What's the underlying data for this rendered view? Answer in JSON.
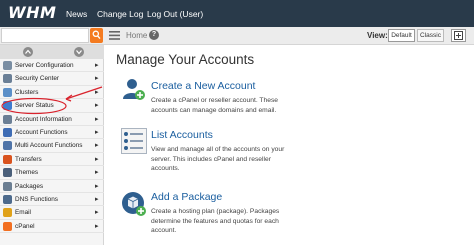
{
  "app": {
    "logo": "WHM"
  },
  "topnav": {
    "news": "News",
    "changelog": "Change Log",
    "logout": "Log Out (User)"
  },
  "breadcrumb": {
    "home": "Home",
    "help": "?"
  },
  "view": {
    "label": "View:",
    "default": "Default",
    "classic": "Classic"
  },
  "search": {
    "value": ""
  },
  "sidebar": {
    "items": [
      {
        "label": "Server Configuration",
        "icon": "server-config-icon",
        "color": "#7a8ea3"
      },
      {
        "label": "Security Center",
        "icon": "security-icon",
        "color": "#6a7f96"
      },
      {
        "label": "Clusters",
        "icon": "clusters-icon",
        "color": "#5b8fc8"
      },
      {
        "label": "Server Status",
        "icon": "server-status-icon",
        "color": "#3f7ccf"
      },
      {
        "label": "Account Information",
        "icon": "account-info-icon",
        "color": "#6b7f95"
      },
      {
        "label": "Account Functions",
        "icon": "account-functions-icon",
        "color": "#3f6db5"
      },
      {
        "label": "Multi Account Functions",
        "icon": "multi-account-icon",
        "color": "#4f74a8"
      },
      {
        "label": "Transfers",
        "icon": "transfers-icon",
        "color": "#d9531e"
      },
      {
        "label": "Themes",
        "icon": "themes-icon",
        "color": "#4a5f7a"
      },
      {
        "label": "Packages",
        "icon": "packages-icon",
        "color": "#6b7e92"
      },
      {
        "label": "DNS Functions",
        "icon": "dns-icon",
        "color": "#4d6a8c"
      },
      {
        "label": "Email",
        "icon": "email-icon",
        "color": "#e0a21a"
      },
      {
        "label": "cPanel",
        "icon": "cpanel-icon",
        "color": "#f26f21"
      }
    ]
  },
  "main": {
    "title": "Manage Your Accounts",
    "features": [
      {
        "title": "Create a New Account",
        "desc": "Create a cPanel or reseller account. These accounts can manage domains and email.",
        "icon": "create-account-icon"
      },
      {
        "title": "List Accounts",
        "desc": "View and manage all of the accounts on your server. This includes cPanel and reseller accounts.",
        "icon": "list-accounts-icon"
      },
      {
        "title": "Add a Package",
        "desc": "Create a hosting plan (package). Packages determine the features and quotas for each account.",
        "icon": "add-package-icon"
      }
    ]
  },
  "colors": {
    "topbar": "#293a4a",
    "accent": "#f47b20",
    "link": "#1a5e9f",
    "annotation": "#d9232d"
  }
}
